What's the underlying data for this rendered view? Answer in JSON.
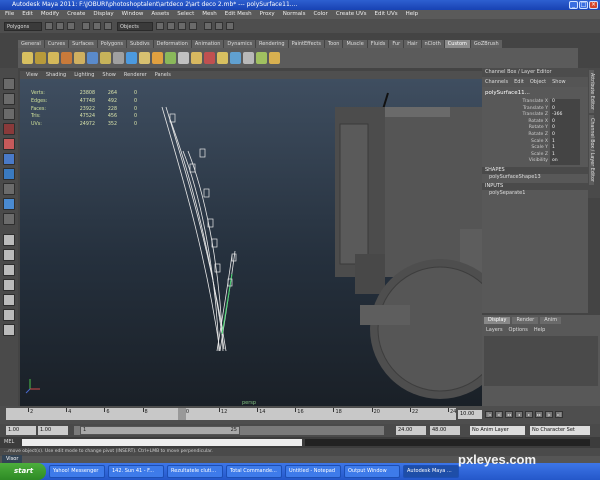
{
  "window": {
    "title": "Autodesk Maya 2011: F:\\JOBURI\\photoshoptalent\\artdeco 2\\art deco 2.mb* --- polySurface11...."
  },
  "menubar": [
    "File",
    "Edit",
    "Modify",
    "Create",
    "Display",
    "Window",
    "Assets",
    "Select",
    "Mesh",
    "Edit Mesh",
    "Proxy",
    "Normals",
    "Color",
    "Create UVs",
    "Edit UVs",
    "Help"
  ],
  "statusline": {
    "mode": "Polygons",
    "objects": "Objects"
  },
  "shelf_tabs": [
    "General",
    "Curves",
    "Surfaces",
    "Polygons",
    "Subdivs",
    "Deformation",
    "Animation",
    "Dynamics",
    "Rendering",
    "PaintEffects",
    "Toon",
    "Muscle",
    "Fluids",
    "Fur",
    "Hair",
    "nCloth",
    "Custom",
    "GoZBrush"
  ],
  "shelf_icon_colors": [
    "#d8c060",
    "#b89a3a",
    "#d4b85a",
    "#c87a3a",
    "#d0b060",
    "#5a8acb",
    "#c7b35a",
    "#a0a0a0",
    "#4c9adf",
    "#d7c070",
    "#e0a040",
    "#8ab85a",
    "#c0c0c0",
    "#d8b860",
    "#c05050",
    "#d8c060",
    "#60a0d0",
    "#b8b8b8",
    "#a0c060",
    "#d8b050"
  ],
  "panel_menu": [
    "View",
    "Shading",
    "Lighting",
    "Show",
    "Renderer",
    "Panels"
  ],
  "hud": {
    "rows": [
      {
        "label": "Verts:",
        "a": "23808",
        "b": "264",
        "c": "0"
      },
      {
        "label": "Edges:",
        "a": "47748",
        "b": "492",
        "c": "0"
      },
      {
        "label": "Faces:",
        "a": "23922",
        "b": "228",
        "c": "0"
      },
      {
        "label": "Tris:",
        "a": "47524",
        "b": "456",
        "c": "0"
      },
      {
        "label": "UVs:",
        "a": "24972",
        "b": "352",
        "c": "0"
      }
    ]
  },
  "channel_box": {
    "header": "Channel Box / Layer Editor",
    "menus": [
      "Channels",
      "Edit",
      "Object",
      "Show"
    ],
    "object": "polySurface11...",
    "channels": [
      {
        "name": "Translate X",
        "value": "0"
      },
      {
        "name": "Translate Y",
        "value": "0"
      },
      {
        "name": "Translate Z",
        "value": "-366"
      },
      {
        "name": "Rotate X",
        "value": "0"
      },
      {
        "name": "Rotate Y",
        "value": "0"
      },
      {
        "name": "Rotate Z",
        "value": "0"
      },
      {
        "name": "Scale X",
        "value": "1"
      },
      {
        "name": "Scale Y",
        "value": "1"
      },
      {
        "name": "Scale Z",
        "value": "1"
      },
      {
        "name": "Visibility",
        "value": "on"
      }
    ],
    "shapes_label": "SHAPES",
    "shape": "polySurfaceShape13",
    "inputs_label": "INPUTS",
    "input": "polySeparate1"
  },
  "side_tabs": [
    "Attribute Editor",
    "Channel Box / Layer Editor"
  ],
  "layer_editor": {
    "tabs": [
      "Display",
      "Render",
      "Anim"
    ],
    "menus": [
      "Layers",
      "Options",
      "Help"
    ]
  },
  "timeline": {
    "ticks": [
      "2",
      "4",
      "6",
      "8",
      "10",
      "12",
      "14",
      "16",
      "18",
      "20",
      "22",
      "24"
    ],
    "current_frame": "10.00",
    "start": "1.00",
    "start2": "1.00",
    "range_start": "1",
    "range_end": "25",
    "end": "24.00",
    "end2": "48.00",
    "anim_layer": "No Anim Layer",
    "character_set": "No Character Set"
  },
  "cmdline": {
    "label": "MEL"
  },
  "helpline": {
    "text": "...move object(s). Use edit mode to change pivot (INSERT). Ctrl+LMB to move perpendicular."
  },
  "viewport_label": "persp",
  "visor": "Visor",
  "taskbar": {
    "start": "start",
    "items": [
      "Yahoo! Messenger",
      "142. Sun 41 - F...",
      "Rezultatele cluti...",
      "Total Commande...",
      "Untitled - Notepad",
      "Output Window",
      "Autodesk Maya ..."
    ]
  },
  "watermark": "pxleyes.com"
}
